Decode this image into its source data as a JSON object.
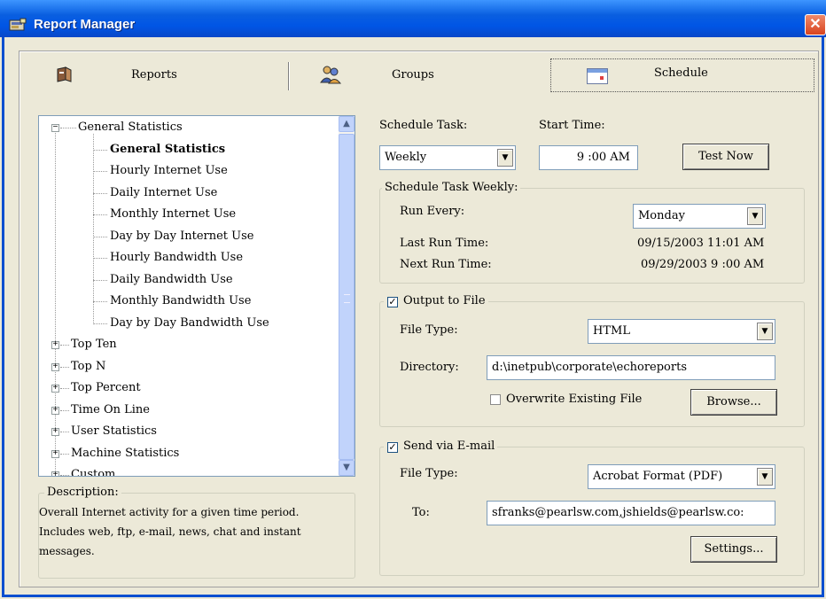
{
  "window": {
    "title": "Report Manager",
    "close_symbol": "✕"
  },
  "tabs": [
    {
      "label": "Reports",
      "icon": "reports-icon"
    },
    {
      "label": "Groups",
      "icon": "groups-icon"
    },
    {
      "label": "Schedule",
      "icon": "calendar-icon"
    }
  ],
  "tree": {
    "root": "General Statistics",
    "children": [
      "General Statistics",
      "Hourly Internet Use",
      "Daily Internet Use",
      "Monthly Internet Use",
      "Day by Day Internet Use",
      "Hourly Bandwidth Use",
      "Daily Bandwidth Use",
      "Monthly Bandwidth Use",
      "Day by Day Bandwidth Use"
    ],
    "collapsed": [
      "Top Ten",
      "Top N",
      "Top Percent",
      "Time On Line",
      "User Statistics",
      "Machine Statistics",
      "Custom"
    ],
    "selected": "General Statistics"
  },
  "description": {
    "legend": "Description:",
    "lines": [
      "Overall Internet activity for a given time period.",
      "Includes web, ftp, e-mail, news, chat and instant",
      "messages."
    ]
  },
  "schedule": {
    "task_label": "Schedule Task:",
    "task_value": "Weekly",
    "start_label": "Start Time:",
    "start_value": "9 :00 AM",
    "test_now": "Test Now",
    "weekly_legend": "Schedule Task Weekly:",
    "run_every_label": "Run Every:",
    "run_every_value": "Monday",
    "last_run_label": "Last Run Time:",
    "last_run_value": "09/15/2003 11:01 AM",
    "next_run_label": "Next Run Time:",
    "next_run_value": "09/29/2003 9 :00 AM"
  },
  "output": {
    "legend": "Output to File",
    "checked": true,
    "file_type_label": "File Type:",
    "file_type_value": "HTML",
    "directory_label": "Directory:",
    "directory_value": "d:\\inetpub\\corporate\\echoreports",
    "overwrite_label": "Overwrite Existing File",
    "overwrite_checked": false,
    "browse": "Browse..."
  },
  "email": {
    "legend": "Send via E-mail",
    "checked": true,
    "file_type_label": "File Type:",
    "file_type_value": "Acrobat Format (PDF)",
    "to_label": "To:",
    "to_value": "sfranks@pearlsw.com,jshields@pearlsw.co:",
    "settings": "Settings..."
  },
  "glyphs": {
    "check": "✓",
    "dropdown": "▼",
    "scroll_up": "▲",
    "scroll_down": "▼",
    "plus": "+",
    "minus": "−"
  }
}
